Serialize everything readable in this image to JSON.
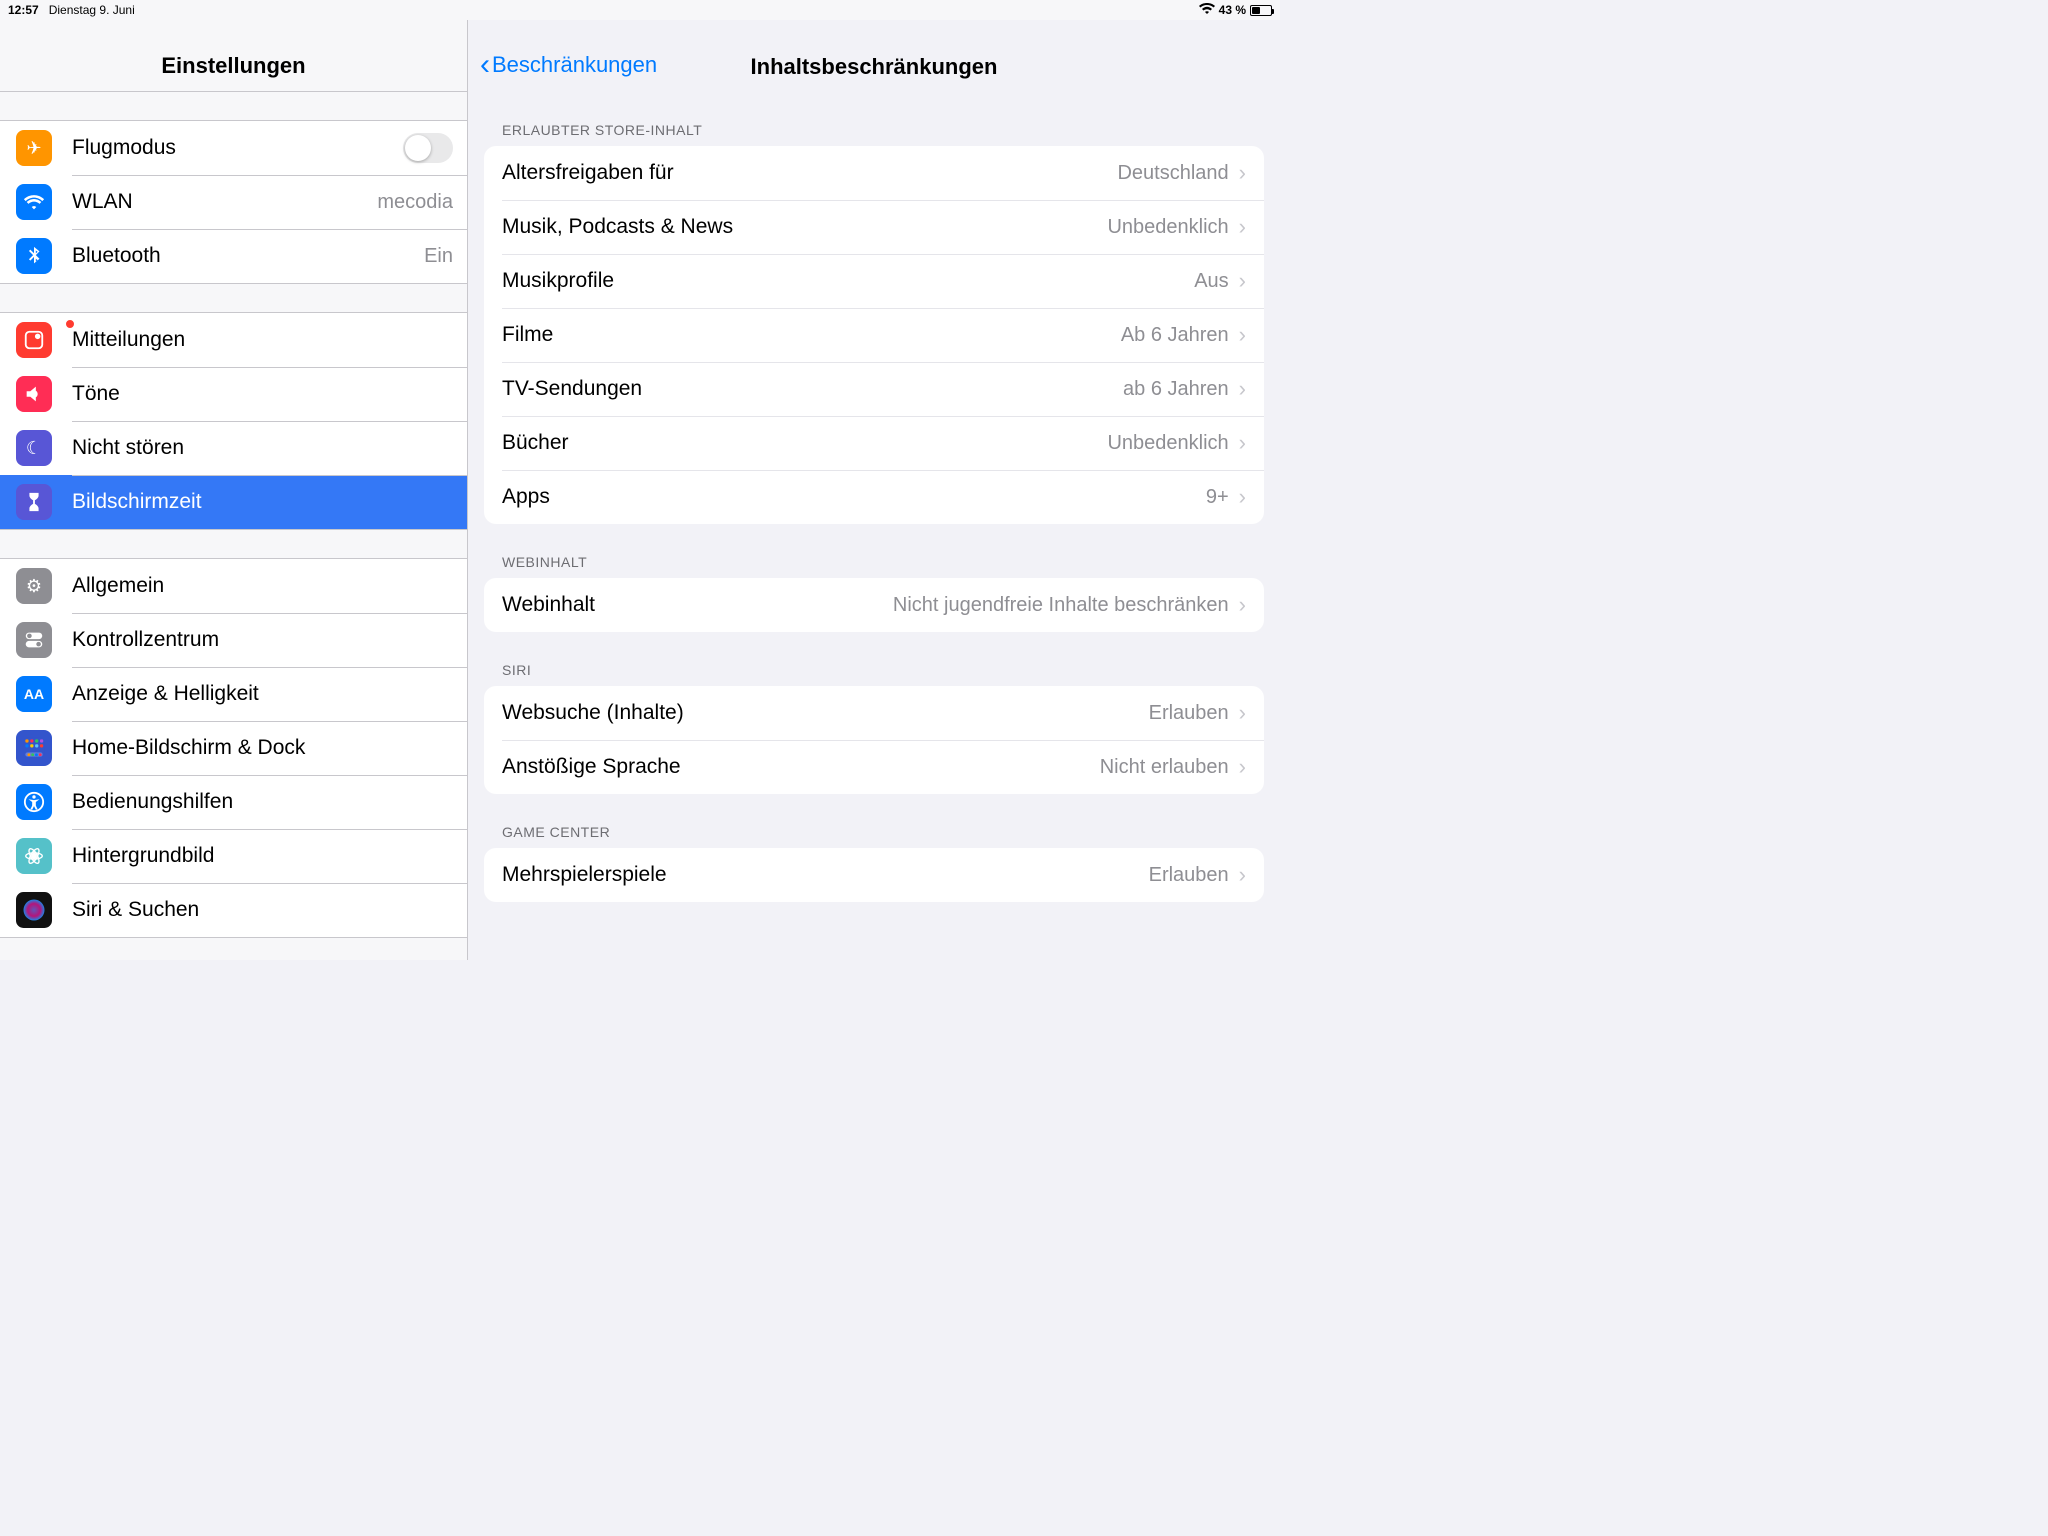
{
  "status": {
    "time": "12:57",
    "date": "Dienstag 9. Juni",
    "battery_percent": "43 %"
  },
  "sidebar": {
    "title": "Einstellungen",
    "groups": [
      [
        {
          "icon": "✈",
          "icon_bg": "#ff9500",
          "label": "Flugmodus",
          "value": "",
          "switch": true
        },
        {
          "icon_svg": "wifi",
          "icon_bg": "#007aff",
          "label": "WLAN",
          "value": "mecodia"
        },
        {
          "icon_svg": "bluetooth",
          "icon_bg": "#007aff",
          "label": "Bluetooth",
          "value": "Ein"
        }
      ],
      [
        {
          "icon_svg": "bell",
          "icon_bg": "#ff3b30",
          "label": "Mitteilungen",
          "badge": true
        },
        {
          "icon_svg": "speaker",
          "icon_bg": "#ff2d55",
          "label": "Töne"
        },
        {
          "icon": "☾",
          "icon_bg": "#5856d6",
          "label": "Nicht stören"
        },
        {
          "icon_svg": "hourglass",
          "icon_bg": "#5856d6",
          "label": "Bildschirmzeit",
          "selected": true
        }
      ],
      [
        {
          "icon": "⚙",
          "icon_bg": "#8e8e93",
          "label": "Allgemein"
        },
        {
          "icon_svg": "toggles",
          "icon_bg": "#8e8e93",
          "label": "Kontrollzentrum"
        },
        {
          "icon": "AA",
          "icon_bg": "#007aff",
          "label": "Anzeige & Helligkeit",
          "icon_text": true
        },
        {
          "icon_svg": "grid",
          "icon_bg": "#3355cc",
          "label": "Home-Bildschirm & Dock"
        },
        {
          "icon_svg": "accessibility",
          "icon_bg": "#007aff",
          "label": "Bedienungshilfen"
        },
        {
          "icon_svg": "flower",
          "icon_bg": "#55c1c9",
          "label": "Hintergrundbild"
        },
        {
          "icon_svg": "siri",
          "icon_bg": "#222",
          "label": "Siri & Suchen"
        }
      ]
    ]
  },
  "detail": {
    "back_label": "Beschränkungen",
    "title": "Inhaltsbeschränkungen",
    "sections": [
      {
        "header": "Erlaubter Store-Inhalt",
        "rows": [
          {
            "label": "Altersfreigaben für",
            "value": "Deutschland"
          },
          {
            "label": "Musik, Podcasts & News",
            "value": "Unbedenklich"
          },
          {
            "label": "Musikprofile",
            "value": "Aus"
          },
          {
            "label": "Filme",
            "value": "Ab 6 Jahren"
          },
          {
            "label": "TV-Sendungen",
            "value": "ab 6 Jahren"
          },
          {
            "label": "Bücher",
            "value": "Unbedenklich"
          },
          {
            "label": "Apps",
            "value": "9+"
          }
        ]
      },
      {
        "header": "Webinhalt",
        "rows": [
          {
            "label": "Webinhalt",
            "value": "Nicht jugendfreie Inhalte beschränken"
          }
        ]
      },
      {
        "header": "Siri",
        "rows": [
          {
            "label": "Websuche (Inhalte)",
            "value": "Erlauben"
          },
          {
            "label": "Anstößige Sprache",
            "value": "Nicht erlauben"
          }
        ]
      },
      {
        "header": "Game Center",
        "rows": [
          {
            "label": "Mehrspielerspiele",
            "value": "Erlauben"
          }
        ]
      }
    ]
  }
}
